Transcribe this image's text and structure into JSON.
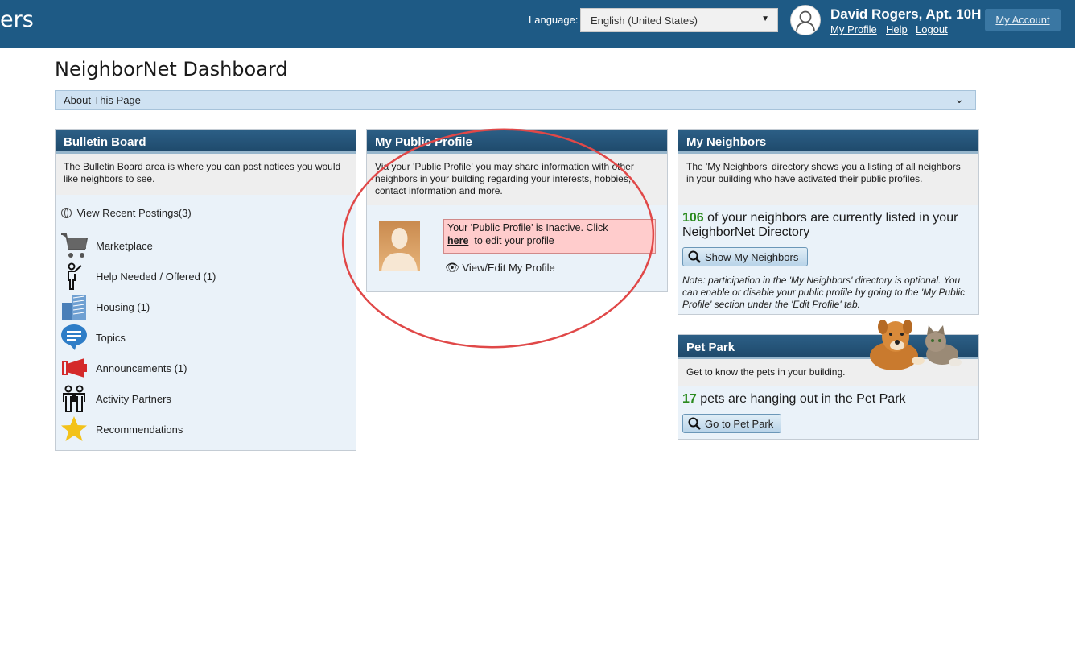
{
  "header": {
    "brand": "ers",
    "language_label": "Language:",
    "language_value": "English (United States)",
    "user_name": "David Rogers, Apt. 10H",
    "links": {
      "my_profile": "My Profile",
      "help": "Help",
      "logout": "Logout"
    },
    "my_account": "My Account"
  },
  "page": {
    "title": "NeighborNet Dashboard",
    "about": "About This Page"
  },
  "bulletin": {
    "title": "Bulletin Board",
    "description": "The Bulletin Board area is where you can post notices you would like neighbors to see.",
    "recent": "View Recent Postings(3)",
    "items": [
      {
        "label": "Marketplace",
        "icon": "cart-icon"
      },
      {
        "label": "Help Needed / Offered (1)",
        "icon": "person-pointing-icon"
      },
      {
        "label": "Housing (1)",
        "icon": "building-icon"
      },
      {
        "label": "Topics",
        "icon": "speech-bubble-icon"
      },
      {
        "label": "Announcements (1)",
        "icon": "megaphone-icon"
      },
      {
        "label": "Activity Partners",
        "icon": "people-icon"
      },
      {
        "label": "Recommendations",
        "icon": "star-icon"
      }
    ]
  },
  "profile": {
    "title": "My Public Profile",
    "description": "Via your 'Public Profile' you may share information with other neighbors in your building regarding your interests, hobbies, contact information and more.",
    "inactive_text": "Your 'Public Profile' is Inactive. Click",
    "here": "here",
    "edit_text": "to edit your profile",
    "view_edit": "View/Edit My Profile"
  },
  "neighbors": {
    "title": "My Neighbors",
    "description": "The 'My Neighbors' directory shows you a listing of all neighbors in your building who have activated their public profiles.",
    "count": "106",
    "count_text": "of your neighbors are currently listed in your NeighborNet Directory",
    "button": "Show My Neighbors",
    "note": "Note: participation in the 'My Neighbors' directory is optional. You can enable or disable your public profile by going to the 'My Public Profile' section under the 'Edit Profile' tab."
  },
  "petpark": {
    "title": "Pet Park",
    "description": "Get to know the pets in your building.",
    "count": "17",
    "count_text": "pets are hanging out in the Pet Park",
    "button": "Go to Pet Park"
  },
  "colors": {
    "header_bg": "#1e5a85",
    "panel_bg": "#eaf2f9",
    "accent_green": "#2a8a1e",
    "highlight_circle": "#e04848",
    "inactive_bg": "#ffcccc"
  }
}
